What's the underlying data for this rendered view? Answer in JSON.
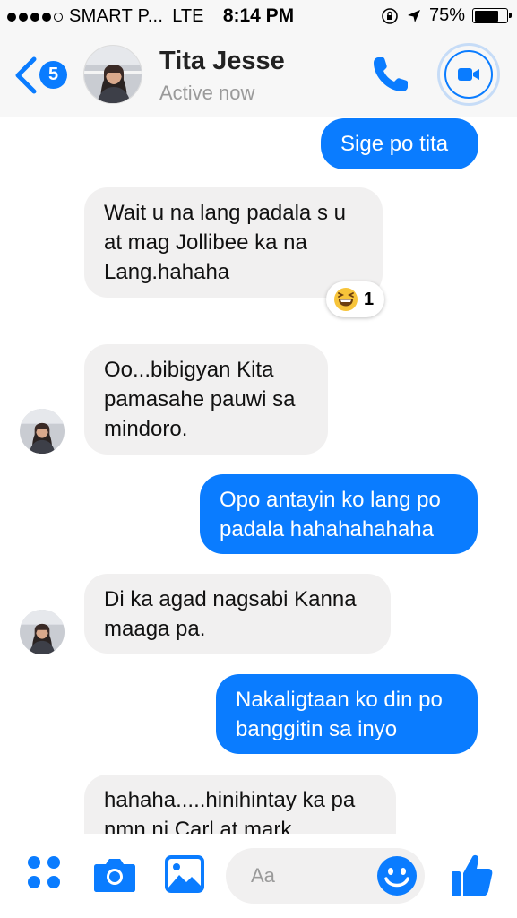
{
  "status_bar": {
    "carrier": "SMART P...",
    "network": "LTE",
    "time": "8:14 PM",
    "battery": "75%",
    "battery_level": 0.75,
    "signal_filled": 4,
    "signal_total": 5
  },
  "header": {
    "unread_count": "5",
    "contact_name": "Tita Jesse",
    "contact_status": "Active now"
  },
  "messages": [
    {
      "from": "me",
      "text": "Sige po tita"
    },
    {
      "from": "them",
      "text": "Wait u na lang padala s u\nat mag Jollibee ka na\nLang.hahaha",
      "reaction": {
        "icon": "laughing-emoji",
        "count": "1"
      }
    },
    {
      "from": "them",
      "text": "Oo...bibigyan Kita\npamasahe pauwi sa\nmindoro.",
      "show_avatar": true
    },
    {
      "from": "me",
      "text": "Opo antayin ko lang po\npadala hahahahahaha"
    },
    {
      "from": "them",
      "text": "Di ka agad nagsabi Kanna\nmaaga pa.",
      "show_avatar": true
    },
    {
      "from": "me",
      "text": "Nakaligtaan ko din po\nbanggitin sa inyo"
    },
    {
      "from": "them",
      "text": "hahaha.....hinihintay ka pa\nnmn ni Carl at mark"
    }
  ],
  "composer": {
    "placeholder": "Aa",
    "icons": [
      "apps-icon",
      "camera-icon",
      "gallery-icon",
      "emoji-icon",
      "thumbs-up-icon"
    ]
  },
  "colors": {
    "accent": "#0a7cff",
    "incoming_bubble": "#f1f0f0",
    "header_bg": "#f7f7f7"
  }
}
